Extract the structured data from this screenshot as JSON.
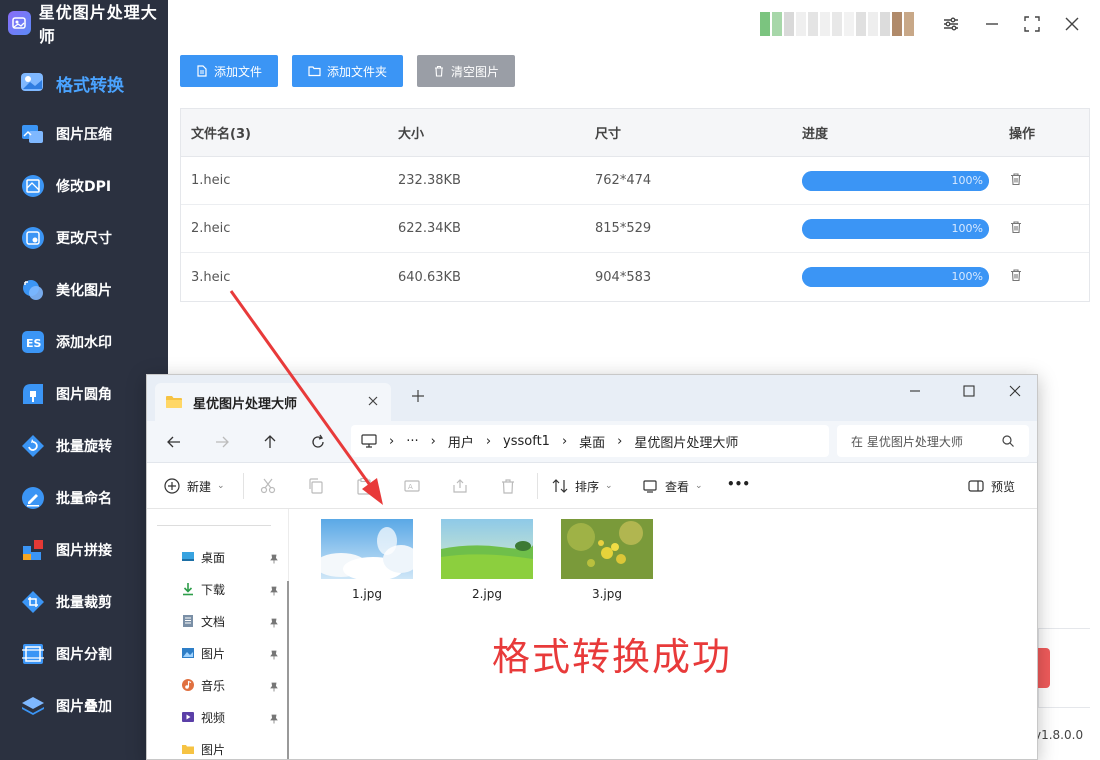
{
  "app": {
    "title": "星优图片处理大师",
    "version": "v1.8.0.0"
  },
  "sidebar": {
    "items": [
      {
        "label": "格式转换",
        "icon": "image-convert-icon",
        "active": true
      },
      {
        "label": "图片压缩",
        "icon": "image-compress-icon"
      },
      {
        "label": "修改DPI",
        "icon": "dpi-icon"
      },
      {
        "label": "更改尺寸",
        "icon": "resize-icon"
      },
      {
        "label": "美化图片",
        "icon": "beautify-icon"
      },
      {
        "label": "添加水印",
        "icon": "watermark-icon"
      },
      {
        "label": "图片圆角",
        "icon": "round-corner-icon"
      },
      {
        "label": "批量旋转",
        "icon": "rotate-icon"
      },
      {
        "label": "批量命名",
        "icon": "rename-icon"
      },
      {
        "label": "图片拼接",
        "icon": "puzzle-icon"
      },
      {
        "label": "批量裁剪",
        "icon": "crop-icon"
      },
      {
        "label": "图片分割",
        "icon": "split-icon"
      },
      {
        "label": "图片叠加",
        "icon": "layers-icon"
      }
    ]
  },
  "toolbar": {
    "add_file": "添加文件",
    "add_folder": "添加文件夹",
    "clear": "清空图片"
  },
  "table": {
    "headers": [
      "文件名(3)",
      "大小",
      "尺寸",
      "进度",
      "操作"
    ],
    "rows": [
      {
        "name": "1.heic",
        "size": "232.38KB",
        "dims": "762*474",
        "progress_text": "100%",
        "progress": 1.0
      },
      {
        "name": "2.heic",
        "size": "622.34KB",
        "dims": "815*529",
        "progress_text": "100%",
        "progress": 1.0
      },
      {
        "name": "3.heic",
        "size": "640.63KB",
        "dims": "904*583",
        "progress_text": "100%",
        "progress": 1.0
      }
    ]
  },
  "explorer": {
    "tab_title": "星优图片处理大师",
    "breadcrumb": [
      "用户",
      "yssoft1",
      "桌面",
      "星优图片处理大师"
    ],
    "search_placeholder": "在 星优图片处理大师",
    "commands": {
      "new": "新建",
      "sort": "排序",
      "view": "查看",
      "more": "•••",
      "preview": "预览"
    },
    "sidebar": [
      {
        "label": "桌面",
        "icon": "desktop-icon"
      },
      {
        "label": "下载",
        "icon": "download-icon"
      },
      {
        "label": "文档",
        "icon": "document-icon"
      },
      {
        "label": "图片",
        "icon": "pictures-icon"
      },
      {
        "label": "音乐",
        "icon": "music-icon"
      },
      {
        "label": "视频",
        "icon": "video-icon"
      },
      {
        "label": "图片",
        "icon": "folder-icon"
      }
    ],
    "files": [
      {
        "name": "1.jpg",
        "thumb": "sky-clouds"
      },
      {
        "name": "2.jpg",
        "thumb": "green-field"
      },
      {
        "name": "3.jpg",
        "thumb": "yellow-flowers"
      }
    ]
  },
  "annotation": {
    "text": "格式转换成功",
    "color": "#e83a3a"
  },
  "colors": {
    "accent": "#3b95f5",
    "sidebar_bg": "#2b3140",
    "active_nav": "#4aa3ff",
    "clear_button": "#9a9ea6"
  }
}
